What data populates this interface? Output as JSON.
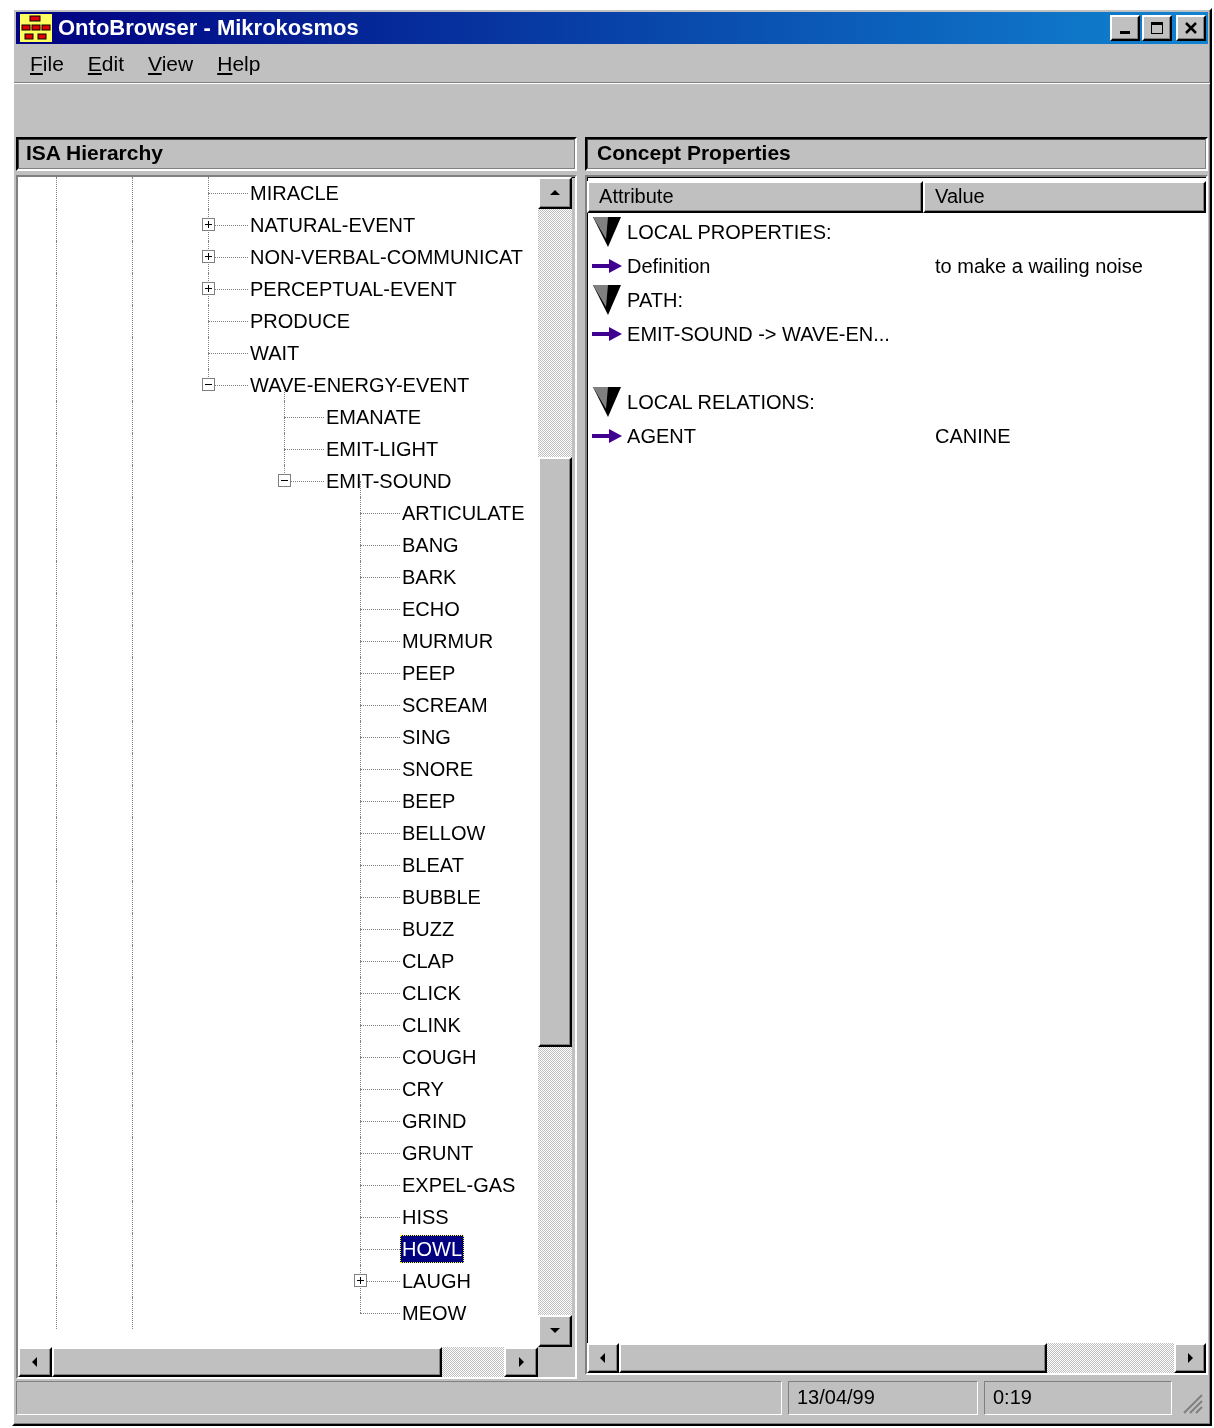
{
  "window": {
    "title": "OntoBrowser - Mikrokosmos"
  },
  "menu": [
    "File",
    "Edit",
    "View",
    "Help"
  ],
  "hierarchy": {
    "title": "ISA Hierarchy",
    "items": [
      {
        "label": "MIRACLE",
        "selected": false
      },
      {
        "label": "NATURAL-EVENT",
        "selected": false,
        "expanded": false
      },
      {
        "label": "NON-VERBAL-COMMUNICAT",
        "selected": false,
        "expanded": false
      },
      {
        "label": "PERCEPTUAL-EVENT",
        "selected": false,
        "expanded": false
      },
      {
        "label": "PRODUCE",
        "selected": false
      },
      {
        "label": "WAIT",
        "selected": false
      },
      {
        "label": "WAVE-ENERGY-EVENT",
        "selected": false,
        "expanded": true,
        "children": [
          {
            "label": "EMANATE",
            "selected": false
          },
          {
            "label": "EMIT-LIGHT",
            "selected": false
          },
          {
            "label": "EMIT-SOUND",
            "selected": false,
            "expanded": true,
            "children": [
              {
                "label": "ARTICULATE",
                "selected": false
              },
              {
                "label": "BANG",
                "selected": false
              },
              {
                "label": "BARK",
                "selected": false
              },
              {
                "label": "ECHO",
                "selected": false
              },
              {
                "label": "MURMUR",
                "selected": false
              },
              {
                "label": "PEEP",
                "selected": false
              },
              {
                "label": "SCREAM",
                "selected": false
              },
              {
                "label": "SING",
                "selected": false
              },
              {
                "label": "SNORE",
                "selected": false
              },
              {
                "label": "BEEP",
                "selected": false
              },
              {
                "label": "BELLOW",
                "selected": false
              },
              {
                "label": "BLEAT",
                "selected": false
              },
              {
                "label": "BUBBLE",
                "selected": false
              },
              {
                "label": "BUZZ",
                "selected": false
              },
              {
                "label": "CLAP",
                "selected": false
              },
              {
                "label": "CLICK",
                "selected": false
              },
              {
                "label": "CLINK",
                "selected": false
              },
              {
                "label": "COUGH",
                "selected": false
              },
              {
                "label": "CRY",
                "selected": false
              },
              {
                "label": "GRIND",
                "selected": false
              },
              {
                "label": "GRUNT",
                "selected": false
              },
              {
                "label": "EXPEL-GAS",
                "selected": false
              },
              {
                "label": "HISS",
                "selected": false
              },
              {
                "label": "HOWL",
                "selected": true
              },
              {
                "label": "LAUGH",
                "selected": false,
                "expanded": false
              },
              {
                "label": "MEOW",
                "selected": false
              }
            ]
          }
        ]
      }
    ]
  },
  "properties": {
    "title": "Concept Properties",
    "columns": [
      "Attribute",
      "Value"
    ],
    "rows": [
      {
        "kind": "heading",
        "attribute": "LOCAL PROPERTIES:"
      },
      {
        "kind": "item",
        "attribute": "Definition",
        "value": "to make a wailing noise"
      },
      {
        "kind": "heading",
        "attribute": "PATH:"
      },
      {
        "kind": "item",
        "attribute": "EMIT-SOUND -> WAVE-EN..."
      },
      {
        "kind": "blank"
      },
      {
        "kind": "heading",
        "attribute": "LOCAL RELATIONS:"
      },
      {
        "kind": "item",
        "attribute": "AGENT",
        "value": "CANINE"
      }
    ]
  },
  "status_bar": {
    "date": "13/04/99",
    "time": "0:19"
  }
}
